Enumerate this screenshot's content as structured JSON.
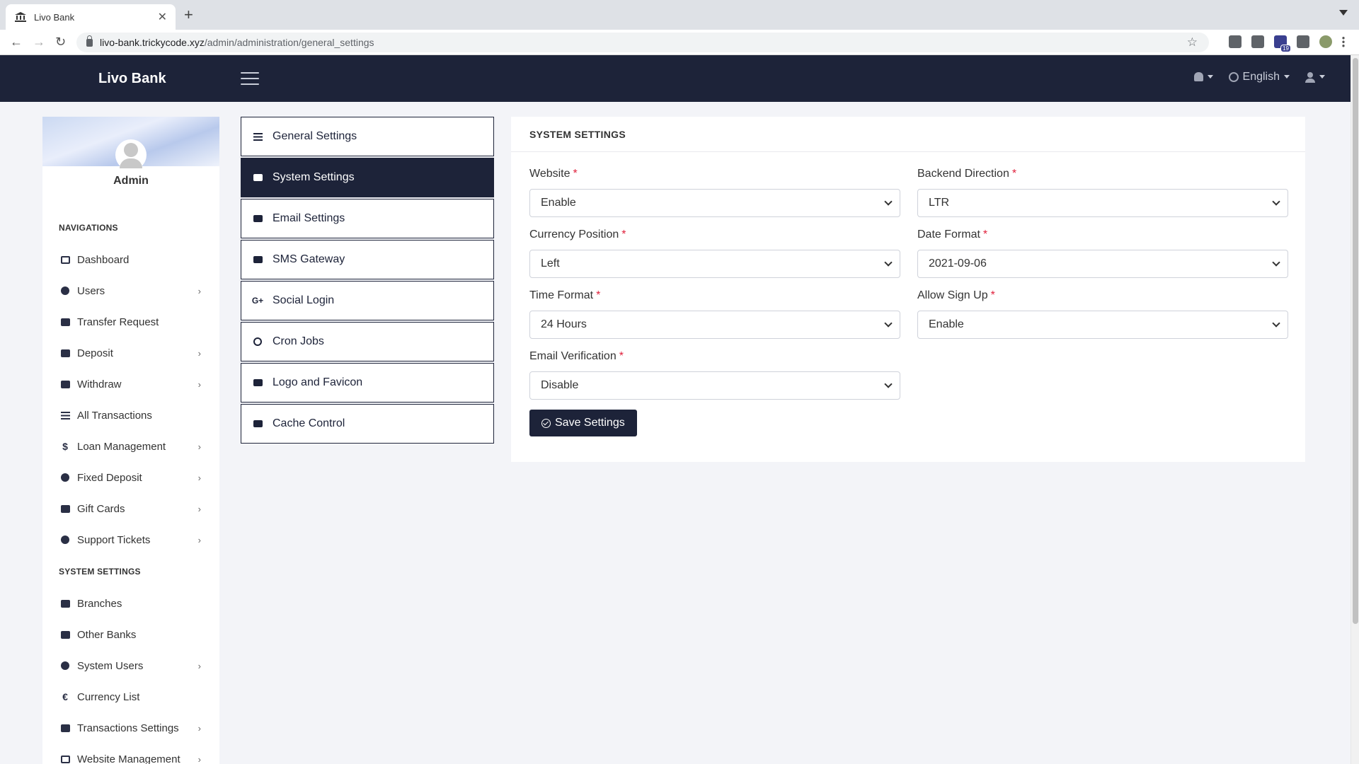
{
  "browser": {
    "tab_title": "Livo Bank",
    "url_host": "livo-bank.trickycode.xyz",
    "url_path": "/admin/administration/general_settings"
  },
  "header": {
    "brand": "Livo Bank",
    "language": "English"
  },
  "sidebar": {
    "admin_name": "Admin",
    "nav_heading": "NAVIGATIONS",
    "system_heading": "SYSTEM SETTINGS",
    "nav_items": [
      {
        "label": "Dashboard",
        "icon": "dashboard-icon",
        "has_arrow": false
      },
      {
        "label": "Users",
        "icon": "users-icon",
        "has_arrow": true
      },
      {
        "label": "Transfer Request",
        "icon": "card-icon",
        "has_arrow": false
      },
      {
        "label": "Deposit",
        "icon": "plus-square-icon",
        "has_arrow": true
      },
      {
        "label": "Withdraw",
        "icon": "minus-square-icon",
        "has_arrow": true
      },
      {
        "label": "All Transactions",
        "icon": "list-icon",
        "has_arrow": false
      },
      {
        "label": "Loan Management",
        "icon": "dollar-icon",
        "has_arrow": true
      },
      {
        "label": "Fixed Deposit",
        "icon": "money-bag-icon",
        "has_arrow": true
      },
      {
        "label": "Gift Cards",
        "icon": "gift-icon",
        "has_arrow": true
      },
      {
        "label": "Support Tickets",
        "icon": "support-icon",
        "has_arrow": true
      }
    ],
    "system_items": [
      {
        "label": "Branches",
        "icon": "sitemap-icon",
        "has_arrow": false
      },
      {
        "label": "Other Banks",
        "icon": "bank-icon",
        "has_arrow": false
      },
      {
        "label": "System Users",
        "icon": "users-icon",
        "has_arrow": true
      },
      {
        "label": "Currency List",
        "icon": "euro-icon",
        "has_arrow": false
      },
      {
        "label": "Transactions Settings",
        "icon": "credit-card-icon",
        "has_arrow": true
      },
      {
        "label": "Website Management",
        "icon": "desktop-icon",
        "has_arrow": true
      }
    ]
  },
  "settings_menu": [
    {
      "label": "General Settings",
      "icon": "sliders-icon",
      "active": false
    },
    {
      "label": "System Settings",
      "icon": "cogs-icon",
      "active": true
    },
    {
      "label": "Email Settings",
      "icon": "envelope-icon",
      "active": false
    },
    {
      "label": "SMS Gateway",
      "icon": "comment-icon",
      "active": false
    },
    {
      "label": "Social Login",
      "icon": "google-plus-icon",
      "active": false
    },
    {
      "label": "Cron Jobs",
      "icon": "clock-icon",
      "active": false
    },
    {
      "label": "Logo and Favicon",
      "icon": "image-icon",
      "active": false
    },
    {
      "label": "Cache Control",
      "icon": "server-icon",
      "active": false
    }
  ],
  "card": {
    "title": "SYSTEM SETTINGS",
    "required_mark": "*",
    "fields": {
      "website": {
        "label": "Website",
        "value": "Enable"
      },
      "backend_direction": {
        "label": "Backend Direction",
        "value": "LTR"
      },
      "currency_position": {
        "label": "Currency Position",
        "value": "Left"
      },
      "date_format": {
        "label": "Date Format",
        "value": "2021-09-06"
      },
      "time_format": {
        "label": "Time Format",
        "value": "24 Hours"
      },
      "allow_signup": {
        "label": "Allow Sign Up",
        "value": "Enable"
      },
      "email_verification": {
        "label": "Email Verification",
        "value": "Disable"
      }
    },
    "save_label": "Save Settings"
  },
  "colors": {
    "primary": "#1d2339",
    "required": "#e0213c",
    "page_bg": "#f3f4f8"
  }
}
